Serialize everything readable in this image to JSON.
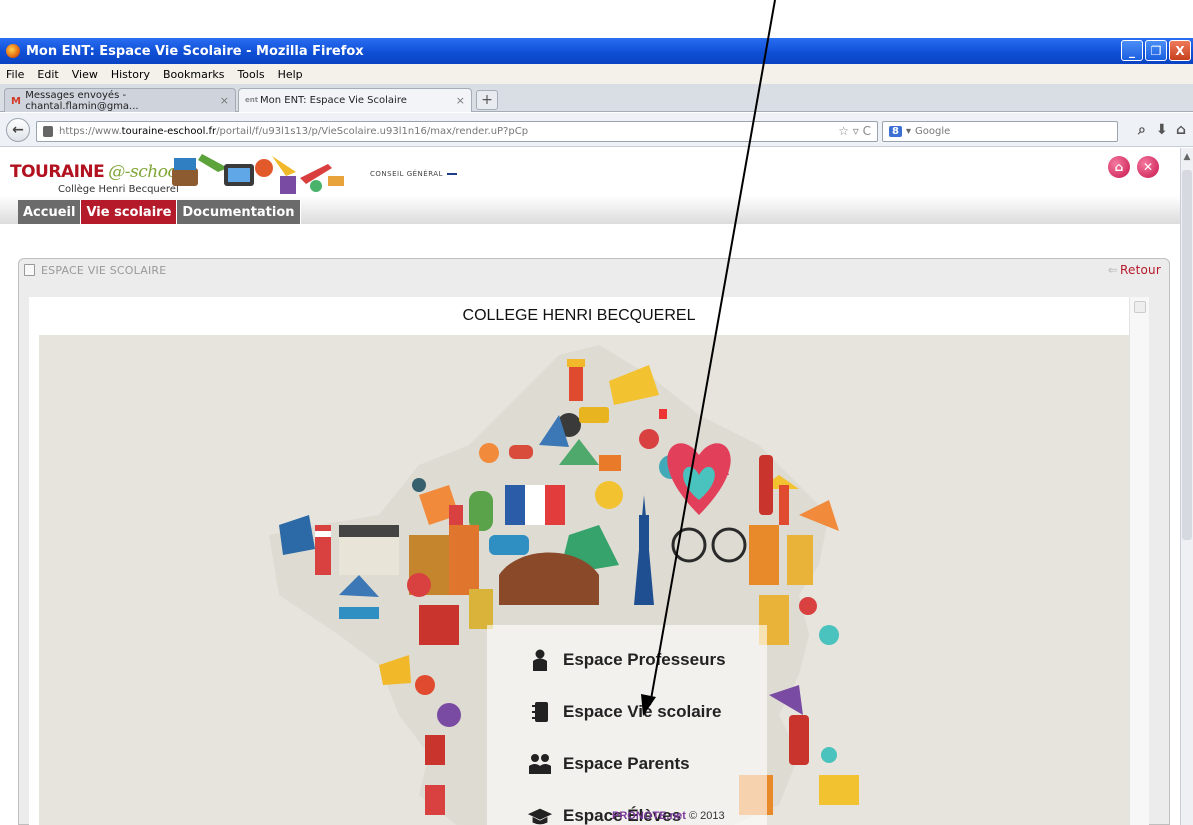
{
  "window": {
    "title": "Mon ENT: Espace Vie Scolaire - Mozilla Firefox",
    "controls": [
      "_",
      "❐",
      "X"
    ]
  },
  "menubar": [
    "File",
    "Edit",
    "View",
    "History",
    "Bookmarks",
    "Tools",
    "Help"
  ],
  "tabs": [
    {
      "favicon": "M",
      "label": "Messages envoyés - chantal.flamin@gma...",
      "close": "×",
      "active": false
    },
    {
      "favicon": "ent",
      "label": "Mon ENT: Espace Vie Scolaire",
      "close": "×",
      "active": true
    }
  ],
  "newtab_label": "+",
  "navbar": {
    "url_prefix": "https://www.",
    "url_domain": "touraine-eschool.fr",
    "url_path": "/portail/f/u93l1s13/p/VieScolaire.u93l1n16/max/render.uP?pCp",
    "search_engine": "8",
    "search_placeholder": "Google"
  },
  "site": {
    "logo_main": "TOURAINE",
    "logo_e": "@-school",
    "logo_sub": "Collège Henri Becquerel",
    "partner": "CONSEIL GÉNÉRAL",
    "nav": [
      "Accueil",
      "Vie scolaire",
      "Documentation"
    ],
    "accent": "#b51a2a"
  },
  "portlet": {
    "title": "ESPACE VIE SCOLAIRE",
    "retour": "Retour"
  },
  "content": {
    "heading": "COLLEGE HENRI BECQUEREL",
    "menu": [
      {
        "label": "Espace Professeurs",
        "icon": "user-icon"
      },
      {
        "label": "Espace Vie scolaire",
        "icon": "notebook-icon"
      },
      {
        "label": "Espace Parents",
        "icon": "users-icon"
      },
      {
        "label": "Espace Élèves",
        "icon": "graduation-cap-icon"
      }
    ],
    "promote_brand": "PRONOTE.net",
    "promote_year": "© 2013"
  }
}
